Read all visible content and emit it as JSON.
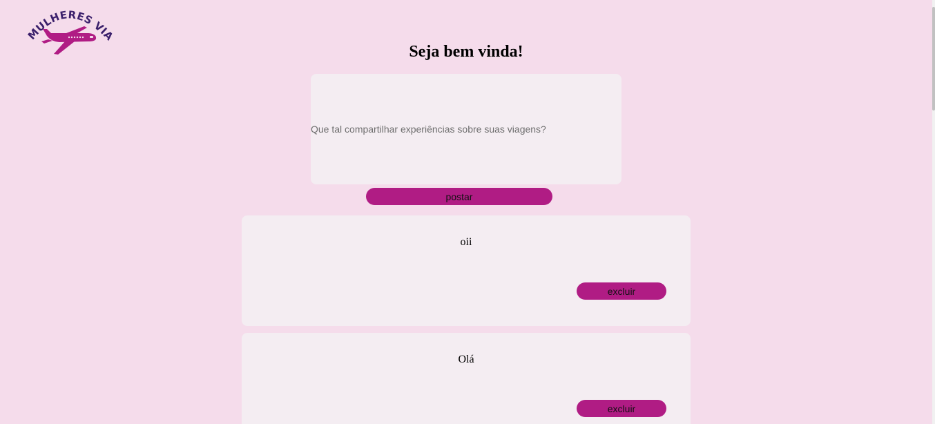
{
  "logo": {
    "text": "MULHERES VIAJANTES",
    "icon": "airplane-icon"
  },
  "header": {
    "title": "Seja bem vinda!"
  },
  "composer": {
    "placeholder": "Que tal compartilhar experiências sobre suas viagens?",
    "value": "",
    "post_label": "postar"
  },
  "posts": [
    {
      "text": "oii",
      "delete_label": "excluir"
    },
    {
      "text": "Olá",
      "delete_label": "excluir"
    }
  ],
  "colors": {
    "background": "#f5dceb",
    "card": "#f4edf2",
    "accent": "#b01c84",
    "logo_text": "#3a1f6b"
  }
}
